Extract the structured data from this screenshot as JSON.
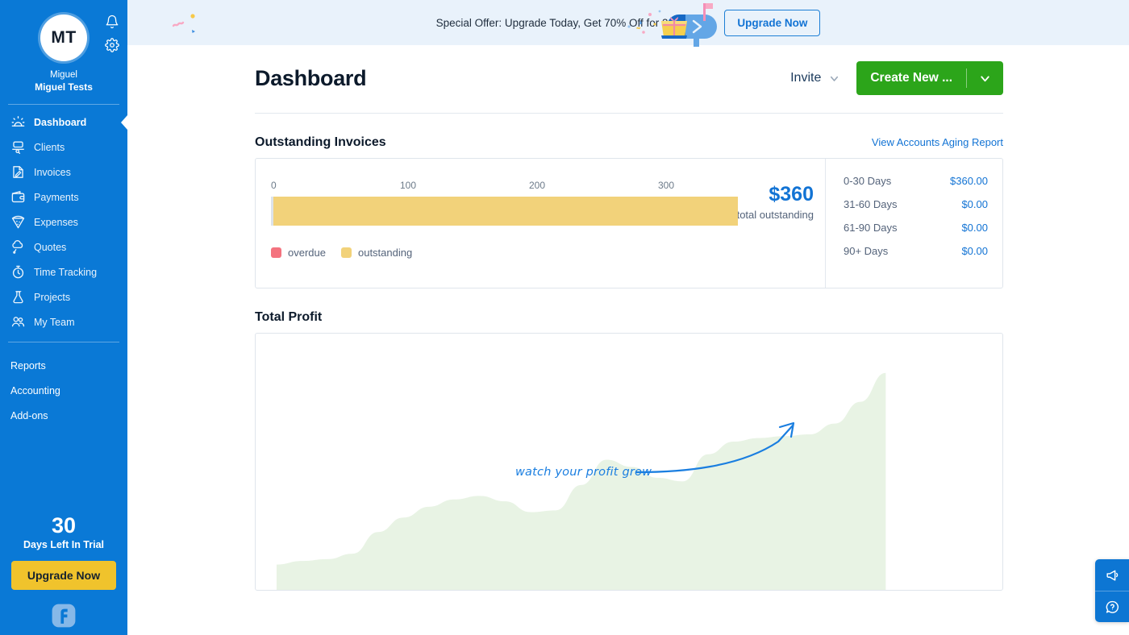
{
  "sidebar": {
    "avatar_initials": "MT",
    "user_first_name": "Miguel",
    "user_account_name": "Miguel Tests",
    "nav_items": [
      {
        "label": "Dashboard",
        "icon": "dashboard-sunrise-icon",
        "active": true
      },
      {
        "label": "Clients",
        "icon": "clients-icon",
        "active": false
      },
      {
        "label": "Invoices",
        "icon": "invoices-icon",
        "active": false
      },
      {
        "label": "Payments",
        "icon": "payments-wallet-icon",
        "active": false
      },
      {
        "label": "Expenses",
        "icon": "expenses-pizza-icon",
        "active": false
      },
      {
        "label": "Quotes",
        "icon": "quotes-bubble-icon",
        "active": false
      },
      {
        "label": "Time Tracking",
        "icon": "stopwatch-icon",
        "active": false
      },
      {
        "label": "Projects",
        "icon": "projects-flask-icon",
        "active": false
      },
      {
        "label": "My Team",
        "icon": "my-team-people-icon",
        "active": false
      }
    ],
    "section_links": [
      "Reports",
      "Accounting",
      "Add-ons"
    ],
    "trial_days": "30",
    "trial_label": "Days Left In Trial",
    "upgrade_button": "Upgrade Now"
  },
  "promo": {
    "text": "Special Offer: Upgrade Today, Get 70% Off for 3 Months.",
    "button": "Upgrade Now"
  },
  "header": {
    "title": "Dashboard",
    "invite_label": "Invite",
    "create_label": "Create New ..."
  },
  "outstanding": {
    "section_title": "Outstanding Invoices",
    "aging_report_link": "View Accounts Aging Report",
    "total_amount": "$360",
    "total_label": "total outstanding",
    "legend": [
      {
        "label": "overdue",
        "color": "#f4737f"
      },
      {
        "label": "outstanding",
        "color": "#f2d27a"
      }
    ],
    "aging": [
      {
        "label": "0-30 Days",
        "value": "$360.00"
      },
      {
        "label": "31-60 Days",
        "value": "$0.00"
      },
      {
        "label": "61-90 Days",
        "value": "$0.00"
      },
      {
        "label": "90+ Days",
        "value": "$0.00"
      }
    ]
  },
  "profit": {
    "section_title": "Total Profit",
    "annotation": "watch your profit grow"
  },
  "help_dock": {
    "announcement_label": "announcements",
    "help_label": "help"
  },
  "chart_data": [
    {
      "type": "bar",
      "title": "Outstanding Invoices",
      "orientation": "horizontal",
      "categories": [
        "outstanding"
      ],
      "series": [
        {
          "name": "overdue",
          "values": [
            0
          ],
          "color": "#f4737f"
        },
        {
          "name": "outstanding",
          "values": [
            360
          ],
          "color": "#f2d27a"
        }
      ],
      "xlabel": "",
      "ylabel": "",
      "xlim": [
        0,
        360
      ],
      "xticks": [
        0,
        100,
        200,
        300
      ],
      "xtick_labels": [
        "0",
        "100",
        "200",
        "300"
      ],
      "grid": false,
      "legend": "bottom-left",
      "total": 360
    },
    {
      "type": "area",
      "title": "Total Profit",
      "xlabel": "",
      "ylabel": "",
      "grid": false,
      "legend": "none",
      "fill_color": "#e8f3e4",
      "annotation": "watch your profit grow",
      "x": [
        0,
        1,
        2,
        3,
        4,
        5,
        6,
        7,
        8,
        9,
        10,
        11,
        12,
        13,
        14,
        15,
        16,
        17,
        18,
        19,
        20,
        21,
        22,
        23,
        24
      ],
      "values": [
        14,
        16,
        17,
        20,
        32,
        40,
        46,
        50,
        52,
        49,
        43,
        44,
        58,
        72,
        68,
        62,
        60,
        75,
        82,
        84,
        85,
        86,
        92,
        104,
        120
      ]
    }
  ]
}
